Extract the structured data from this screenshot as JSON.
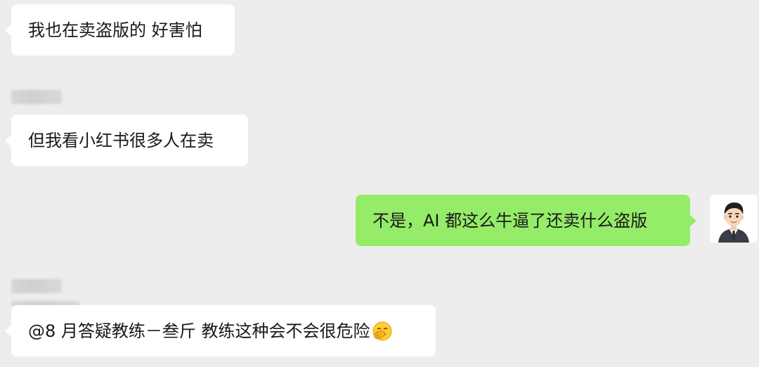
{
  "messages": [
    {
      "side": "left",
      "text": "我也在卖盗版的 好害怕"
    },
    {
      "side": "left",
      "text": "但我看小红书很多人在卖"
    },
    {
      "side": "right",
      "text": "不是，AI 都这么牛逼了还卖什么盗版"
    },
    {
      "side": "left",
      "text": "@8 月答疑教练－叁斤 教练这种会不会很危险"
    }
  ],
  "icons": {
    "emoji": "face-with-hand-over-mouth-icon",
    "avatar": "cartoon-man-in-suit-avatar"
  },
  "colors": {
    "background": "#ededed",
    "incoming_bubble": "#ffffff",
    "outgoing_bubble": "#95ec69",
    "text": "#191919"
  }
}
